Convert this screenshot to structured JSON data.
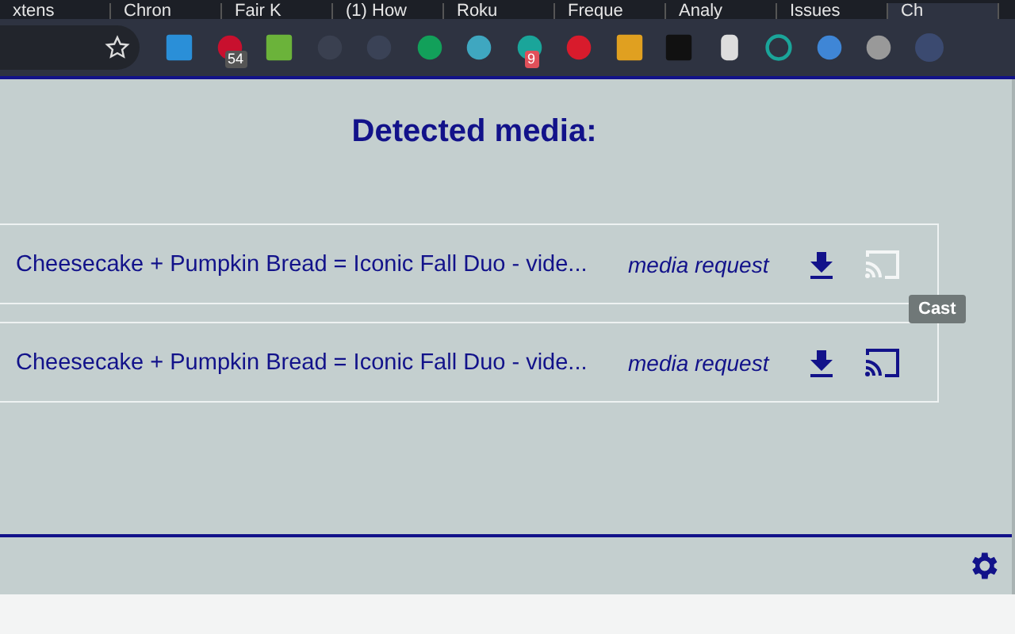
{
  "browser": {
    "tabs": [
      {
        "title": "xtens",
        "selected": false
      },
      {
        "title": "Chron",
        "selected": false
      },
      {
        "title": "Fair K",
        "selected": false
      },
      {
        "title": "(1) How",
        "selected": false
      },
      {
        "title": "Roku",
        "selected": false
      },
      {
        "title": "Freque",
        "selected": false
      },
      {
        "title": "Analy",
        "selected": false
      },
      {
        "title": "Issues",
        "selected": false
      },
      {
        "title": "Ch",
        "selected": true
      }
    ],
    "extensions": [
      {
        "kind": "calendar"
      },
      {
        "kind": "badge-red",
        "badge": "54"
      },
      {
        "kind": "green-square"
      },
      {
        "kind": "faded"
      },
      {
        "kind": "circle-gray"
      },
      {
        "kind": "green-blob"
      },
      {
        "kind": "atom"
      },
      {
        "kind": "teal-a",
        "badge": "9"
      },
      {
        "kind": "red-circle"
      },
      {
        "kind": "k"
      },
      {
        "kind": "terminal"
      },
      {
        "kind": "cylinder"
      },
      {
        "kind": "target"
      },
      {
        "kind": "v"
      },
      {
        "kind": "elephant"
      },
      {
        "kind": "cast"
      }
    ]
  },
  "popup": {
    "title": "Detected media:",
    "items": [
      {
        "title": "Cheesecake + Pumpkin Bread = Iconic Fall Duo - vide...",
        "request": "media request",
        "cast_enabled": false
      },
      {
        "title": "Cheesecake + Pumpkin Bread = Iconic Fall Duo - vide...",
        "request": "media request",
        "cast_enabled": true
      }
    ],
    "tooltip": "Cast"
  }
}
